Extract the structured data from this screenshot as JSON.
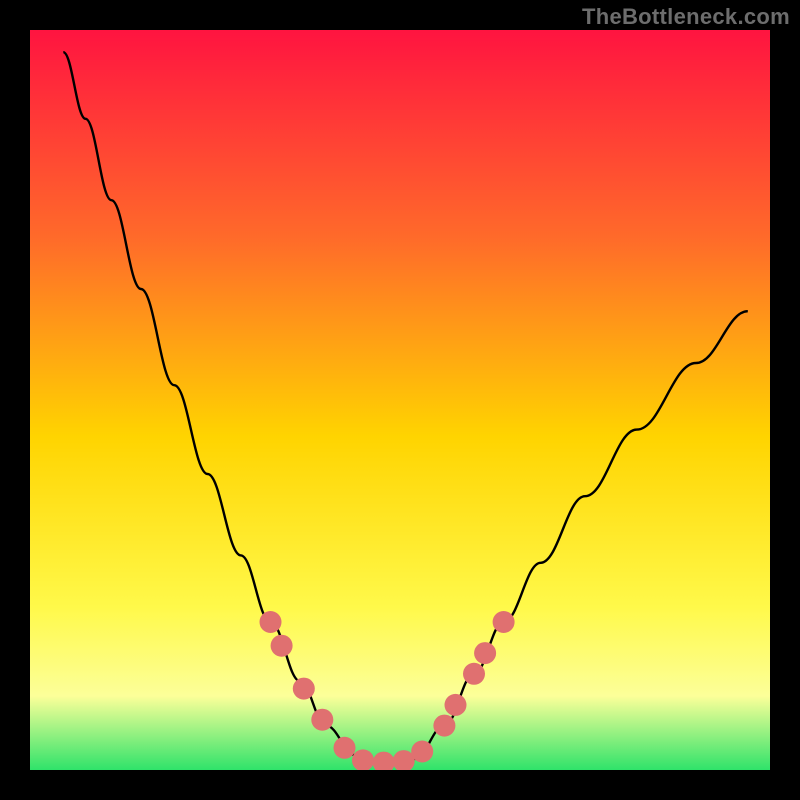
{
  "watermark": "TheBottleneck.com",
  "chart_data": {
    "type": "line",
    "title": "",
    "xlabel": "",
    "ylabel": "",
    "xlim": [
      0,
      1
    ],
    "ylim": [
      0,
      1
    ],
    "legend": false,
    "grid": false,
    "gradient": {
      "top": "#ff1440",
      "upper_mid": "#ff6a2a",
      "mid": "#ffd400",
      "lower_mid": "#fff94a",
      "band": "#fcff99",
      "bottom": "#2fe36a"
    },
    "curve_color": "#000000",
    "curve": [
      {
        "x": 0.045,
        "y": 0.97
      },
      {
        "x": 0.075,
        "y": 0.88
      },
      {
        "x": 0.11,
        "y": 0.77
      },
      {
        "x": 0.15,
        "y": 0.65
      },
      {
        "x": 0.195,
        "y": 0.52
      },
      {
        "x": 0.24,
        "y": 0.4
      },
      {
        "x": 0.285,
        "y": 0.29
      },
      {
        "x": 0.325,
        "y": 0.2
      },
      {
        "x": 0.365,
        "y": 0.12
      },
      {
        "x": 0.4,
        "y": 0.06
      },
      {
        "x": 0.44,
        "y": 0.02
      },
      {
        "x": 0.48,
        "y": 0.01
      },
      {
        "x": 0.52,
        "y": 0.015
      },
      {
        "x": 0.56,
        "y": 0.06
      },
      {
        "x": 0.6,
        "y": 0.13
      },
      {
        "x": 0.64,
        "y": 0.2
      },
      {
        "x": 0.69,
        "y": 0.28
      },
      {
        "x": 0.75,
        "y": 0.37
      },
      {
        "x": 0.82,
        "y": 0.46
      },
      {
        "x": 0.9,
        "y": 0.55
      },
      {
        "x": 0.97,
        "y": 0.62
      }
    ],
    "marker_color": "#e07070",
    "marker_radius_px": 11,
    "markers": [
      {
        "x": 0.325,
        "y": 0.2
      },
      {
        "x": 0.34,
        "y": 0.168
      },
      {
        "x": 0.37,
        "y": 0.11
      },
      {
        "x": 0.395,
        "y": 0.068
      },
      {
        "x": 0.425,
        "y": 0.03
      },
      {
        "x": 0.45,
        "y": 0.013
      },
      {
        "x": 0.478,
        "y": 0.01
      },
      {
        "x": 0.505,
        "y": 0.012
      },
      {
        "x": 0.53,
        "y": 0.025
      },
      {
        "x": 0.56,
        "y": 0.06
      },
      {
        "x": 0.575,
        "y": 0.088
      },
      {
        "x": 0.6,
        "y": 0.13
      },
      {
        "x": 0.615,
        "y": 0.158
      },
      {
        "x": 0.64,
        "y": 0.2
      }
    ]
  }
}
